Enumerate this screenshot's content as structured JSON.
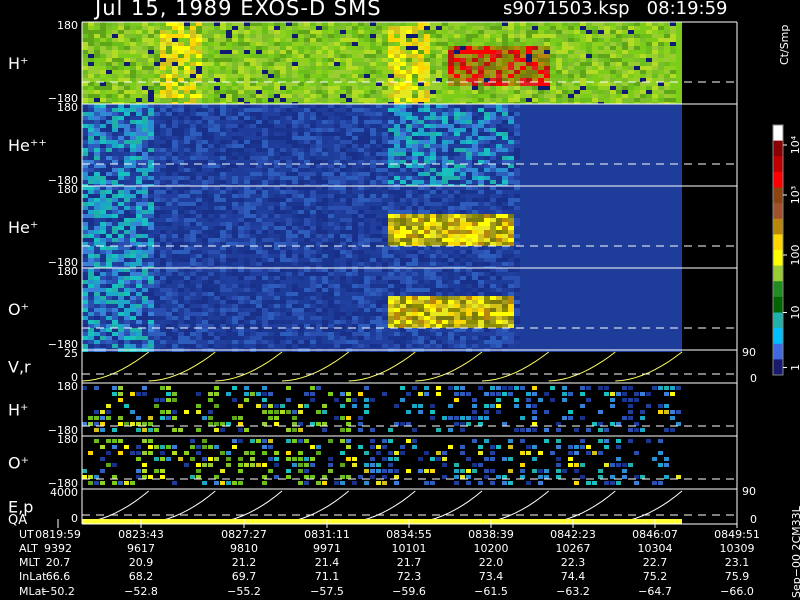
{
  "header": {
    "title": "Jul 15, 1989   EXOS-D SMS",
    "file": "s9071503.ksp",
    "time": "08:19:59"
  },
  "colorbar": {
    "title": "Ct/Smp",
    "ticks": [
      "10⁴",
      "10³",
      "100",
      "10",
      "1"
    ],
    "colors": [
      "#ffffff",
      "#8b0000",
      "#c00000",
      "#ff0000",
      "#8b4513",
      "#a0522d",
      "#b8860b",
      "#ffd700",
      "#ffff00",
      "#9acd32",
      "#228b22",
      "#006400",
      "#20b2aa",
      "#00bfff",
      "#4169e1",
      "#191970"
    ]
  },
  "panels": [
    {
      "id": "h-plus",
      "label": "H⁺",
      "ymax": "180",
      "ymin": "−180",
      "dominant": "#7ccd1a"
    },
    {
      "id": "he-plus-plus",
      "label": "He⁺⁺",
      "ymax": "180",
      "ymin": "−180",
      "dominant": "#1e3c9a"
    },
    {
      "id": "he-plus",
      "label": "He⁺",
      "ymax": "180",
      "ymin": "−180",
      "dominant": "#1e3c9a"
    },
    {
      "id": "o-plus",
      "label": "O⁺",
      "ymax": "180",
      "ymin": "−180",
      "dominant": "#1e3c9a"
    },
    {
      "id": "v-r",
      "label": "V,r",
      "ymax": "25",
      "ymin": "0",
      "right_top": "90",
      "right_bottom": "0"
    },
    {
      "id": "h-plus-2",
      "label": "H⁺",
      "ymax": "180",
      "ymin": "−180"
    },
    {
      "id": "o-plus-2",
      "label": "O⁺",
      "ymax": "180",
      "ymin": "−180"
    },
    {
      "id": "e-p",
      "label": "E,p",
      "label2": "QA",
      "ymax": "4000",
      "ymin": "0",
      "right_top": "90",
      "right_bottom": "0"
    }
  ],
  "table": {
    "rows": [
      {
        "label": "UT",
        "values": [
          "0819:59",
          "0823:43",
          "0827:27",
          "0831:11",
          "0834:55",
          "0838:39",
          "0842:23",
          "0846:07",
          "0849:51"
        ]
      },
      {
        "label": "ALT",
        "values": [
          "9392",
          "9617",
          "9810",
          "9971",
          "10101",
          "10200",
          "10267",
          "10304",
          "10309"
        ]
      },
      {
        "label": "MLT",
        "values": [
          "20.7",
          "20.9",
          "21.2",
          "21.4",
          "21.7",
          "22.0",
          "22.3",
          "22.7",
          "23.1"
        ]
      },
      {
        "label": "InLat",
        "values": [
          "66.6",
          "68.2",
          "69.7",
          "71.1",
          "72.3",
          "73.4",
          "74.4",
          "75.2",
          "75.9"
        ]
      },
      {
        "label": "MLat",
        "values": [
          "−50.2",
          "−52.8",
          "−55.2",
          "−57.5",
          "−59.6",
          "−61.5",
          "−63.2",
          "−64.7",
          "−66.0"
        ]
      }
    ]
  },
  "footer_vertical": "Sep−00  2CM33L",
  "chart_data": {
    "type": "heatmap",
    "title": "Jul 15, 1989   EXOS-D SMS",
    "x": [
      "0819:59",
      "0823:43",
      "0827:27",
      "0831:11",
      "0834:55",
      "0838:39",
      "0842:23",
      "0846:07",
      "0849:51"
    ],
    "series": [
      {
        "name": "H⁺",
        "ylim": [
          -180,
          180
        ]
      },
      {
        "name": "He⁺⁺",
        "ylim": [
          -180,
          180
        ]
      },
      {
        "name": "He⁺",
        "ylim": [
          -180,
          180
        ]
      },
      {
        "name": "O⁺",
        "ylim": [
          -180,
          180
        ]
      },
      {
        "name": "V,r",
        "ylim": [
          0,
          25
        ]
      },
      {
        "name": "H⁺",
        "ylim": [
          -180,
          180
        ]
      },
      {
        "name": "O⁺",
        "ylim": [
          -180,
          180
        ]
      },
      {
        "name": "E,p",
        "ylim": [
          0,
          4000
        ]
      }
    ],
    "colorbar_label": "Ct/Smp"
  }
}
